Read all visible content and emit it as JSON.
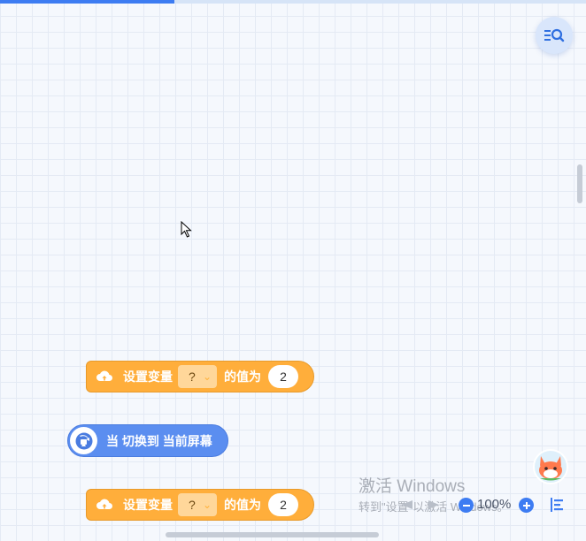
{
  "canvas": {
    "background": "#f5f8fd",
    "grid_color": "#e4eaf4"
  },
  "toolbar": {
    "search_icon": "list-search-icon"
  },
  "blocks": [
    {
      "kind": "set-variable",
      "label": "设置变量",
      "variable": "?",
      "middle_label": "的值为",
      "value": "2",
      "color": "#ffae3b",
      "icon": "cloud-upload-icon"
    },
    {
      "kind": "event",
      "label": "当 切换到 当前屏幕",
      "color": "#5b8ef0",
      "icon": "screen-switch-icon"
    },
    {
      "kind": "set-variable",
      "label": "设置变量",
      "variable": "?",
      "middle_label": "的值为",
      "value": "2",
      "color": "#ffae3b",
      "icon": "cloud-upload-icon"
    }
  ],
  "watermark": {
    "title": "激活 Windows",
    "subtitle": "转到\"设置\"以激活 Windows。"
  },
  "zoom": {
    "level": "100%"
  },
  "colors": {
    "accent": "#3d7cf2"
  }
}
